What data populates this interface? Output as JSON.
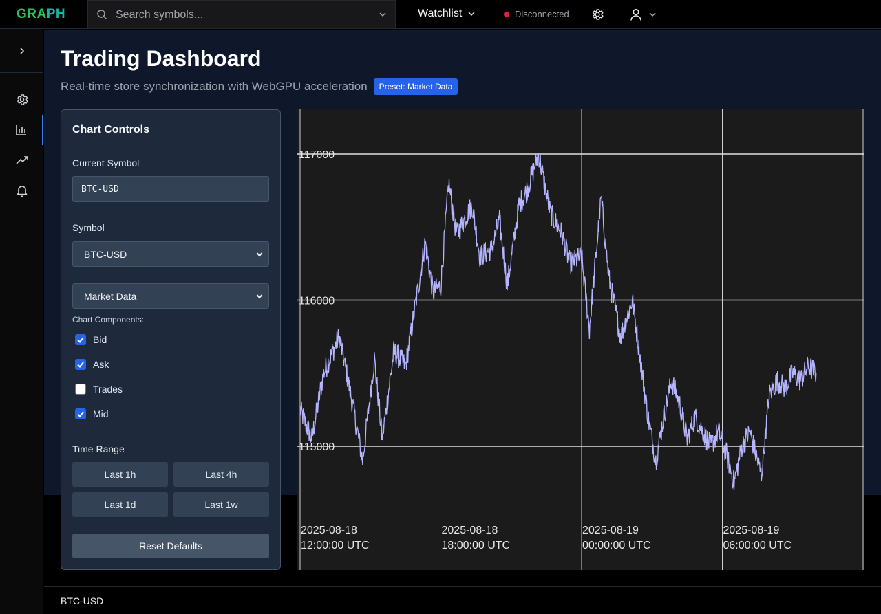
{
  "app": {
    "logo_part1": "GRA",
    "logo_part2": "PH"
  },
  "search": {
    "placeholder": "Search symbols..."
  },
  "header": {
    "watchlist_label": "Watchlist",
    "status_text": "Disconnected",
    "status_color": "#e11d48"
  },
  "page": {
    "title": "Trading Dashboard",
    "subtitle": "Real-time store synchronization with WebGPU acceleration",
    "preset_badge": "Preset: Market Data"
  },
  "controls": {
    "title": "Chart Controls",
    "current_symbol_label": "Current Symbol",
    "current_symbol_value": "BTC-USD",
    "symbol_label": "Symbol",
    "symbol_selected": "BTC-USD",
    "preset_selected": "Market Data",
    "components_label": "Chart Components:",
    "components": [
      {
        "label": "Bid",
        "checked": true
      },
      {
        "label": "Ask",
        "checked": true
      },
      {
        "label": "Trades",
        "checked": false
      },
      {
        "label": "Mid",
        "checked": true
      }
    ],
    "time_range_label": "Time Range",
    "time_ranges": [
      "Last 1h",
      "Last 4h",
      "Last 1d",
      "Last 1w"
    ],
    "reset_label": "Reset Defaults"
  },
  "chart_data": {
    "type": "line",
    "series": [
      {
        "values": []
      }
    ],
    "y_ticks": [
      "117000",
      "116000",
      "115000"
    ],
    "y_tick_values": [
      117000,
      116000,
      115000
    ],
    "ylim": [
      114450,
      117300
    ],
    "x_ticks": [
      {
        "date": "2025-08-18",
        "time": "12:00:00 UTC"
      },
      {
        "date": "2025-08-18",
        "time": "18:00:00 UTC"
      },
      {
        "date": "2025-08-19",
        "time": "00:00:00 UTC"
      },
      {
        "date": "2025-08-19",
        "time": "06:00:00 UTC"
      }
    ],
    "keyframes": [
      [
        "2025-08-18 12:00",
        115250
      ],
      [
        "2025-08-18 12:30",
        115050
      ],
      [
        "2025-08-18 13:00",
        115500
      ],
      [
        "2025-08-18 13:40",
        115750
      ],
      [
        "2025-08-18 14:10",
        115350
      ],
      [
        "2025-08-18 14:40",
        114900
      ],
      [
        "2025-08-18 15:10",
        115600
      ],
      [
        "2025-08-18 15:30",
        115050
      ],
      [
        "2025-08-18 16:00",
        115650
      ],
      [
        "2025-08-18 16:30",
        115550
      ],
      [
        "2025-08-18 17:00",
        116050
      ],
      [
        "2025-08-18 17:20",
        116400
      ],
      [
        "2025-08-18 17:40",
        116050
      ],
      [
        "2025-08-18 18:00",
        116100
      ],
      [
        "2025-08-18 18:20",
        116800
      ],
      [
        "2025-08-18 18:40",
        116450
      ],
      [
        "2025-08-18 19:00",
        116550
      ],
      [
        "2025-08-18 19:20",
        116650
      ],
      [
        "2025-08-18 19:40",
        116300
      ],
      [
        "2025-08-18 20:10",
        116350
      ],
      [
        "2025-08-18 20:30",
        116550
      ],
      [
        "2025-08-18 20:50",
        116100
      ],
      [
        "2025-08-18 21:20",
        116650
      ],
      [
        "2025-08-18 21:40",
        116750
      ],
      [
        "2025-08-18 22:10",
        117000
      ],
      [
        "2025-08-18 22:40",
        116600
      ],
      [
        "2025-08-18 23:10",
        116450
      ],
      [
        "2025-08-18 23:30",
        116250
      ],
      [
        "2025-08-19 00:00",
        116300
      ],
      [
        "2025-08-19 00:20",
        115800
      ],
      [
        "2025-08-19 00:50",
        116700
      ],
      [
        "2025-08-19 01:10",
        116150
      ],
      [
        "2025-08-19 01:40",
        115750
      ],
      [
        "2025-08-19 02:10",
        116000
      ],
      [
        "2025-08-19 02:30",
        115600
      ],
      [
        "2025-08-19 02:50",
        115200
      ],
      [
        "2025-08-19 03:10",
        114900
      ],
      [
        "2025-08-19 03:30",
        115200
      ],
      [
        "2025-08-19 03:50",
        115450
      ],
      [
        "2025-08-19 04:10",
        115300
      ],
      [
        "2025-08-19 04:30",
        115050
      ],
      [
        "2025-08-19 04:50",
        115200
      ],
      [
        "2025-08-19 05:10",
        115100
      ],
      [
        "2025-08-19 05:30",
        115000
      ],
      [
        "2025-08-19 05:50",
        115100
      ],
      [
        "2025-08-19 06:10",
        114950
      ],
      [
        "2025-08-19 06:30",
        114750
      ],
      [
        "2025-08-19 06:50",
        115000
      ],
      [
        "2025-08-19 07:10",
        115100
      ],
      [
        "2025-08-19 07:40",
        114800
      ],
      [
        "2025-08-19 08:00",
        115350
      ],
      [
        "2025-08-19 08:20",
        115450
      ],
      [
        "2025-08-19 08:40",
        115400
      ],
      [
        "2025-08-19 09:00",
        115500
      ],
      [
        "2025-08-19 09:20",
        115450
      ],
      [
        "2025-08-19 09:40",
        115550
      ],
      [
        "2025-08-19 10:00",
        115500
      ]
    ]
  },
  "footer": {
    "symbol": "BTC-USD"
  }
}
